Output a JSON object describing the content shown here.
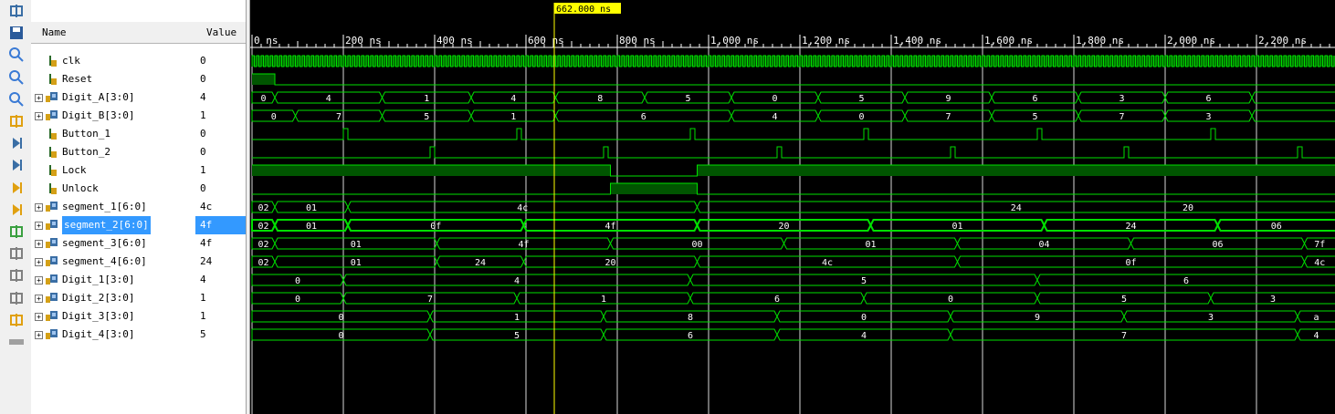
{
  "headers": {
    "name": "Name",
    "value": "Value"
  },
  "cursor": {
    "label": "662.000 ns",
    "time_ns": 662
  },
  "axis_labels": [
    "0 ns",
    "200 ns",
    "400 ns",
    "600 ns",
    "800 ns",
    "1,000 ns",
    "1,200 ns",
    "1,400 ns",
    "1,600 ns",
    "1,800 ns",
    "2,000 ns",
    "2,200 ns"
  ],
  "toolbar": [
    "expand-icon",
    "save-icon",
    "zoom-in-icon",
    "zoom-out-icon",
    "zoom-fit-icon",
    "cursor-icon",
    "go-to-start-icon",
    "go-to-end-icon",
    "previous-transition-icon",
    "next-transition-icon",
    "add-marker-icon",
    "previous-marker-icon",
    "next-marker-icon",
    "swap-icon",
    "snap-icon",
    "grid-icon"
  ],
  "signals": [
    {
      "name": "clk",
      "value": "0",
      "kind": "clock",
      "bus": false
    },
    {
      "name": "Reset",
      "value": "0",
      "kind": "bit",
      "bus": false,
      "segments": [
        [
          0,
          50,
          1
        ],
        [
          50,
          2400,
          0
        ]
      ]
    },
    {
      "name": "Digit_A[3:0]",
      "value": "4",
      "kind": "bus",
      "bus": true,
      "segments": [
        [
          0,
          50,
          "0"
        ],
        [
          50,
          285,
          "4"
        ],
        [
          285,
          480,
          "1"
        ],
        [
          480,
          665,
          "4"
        ],
        [
          665,
          860,
          "8"
        ],
        [
          860,
          1050,
          "5"
        ],
        [
          1050,
          1240,
          "0"
        ],
        [
          1240,
          1430,
          "5"
        ],
        [
          1430,
          1620,
          "9"
        ],
        [
          1620,
          1810,
          "6"
        ],
        [
          1810,
          2000,
          "3"
        ],
        [
          2000,
          2190,
          "6"
        ],
        [
          2190,
          2400,
          ""
        ]
      ]
    },
    {
      "name": "Digit_B[3:0]",
      "value": "1",
      "kind": "bus",
      "bus": true,
      "segments": [
        [
          0,
          95,
          "0"
        ],
        [
          95,
          285,
          "7"
        ],
        [
          285,
          480,
          "5"
        ],
        [
          480,
          665,
          "1"
        ],
        [
          665,
          1050,
          "6"
        ],
        [
          1050,
          1240,
          "4"
        ],
        [
          1240,
          1430,
          "0"
        ],
        [
          1430,
          1620,
          "7"
        ],
        [
          1620,
          1810,
          "5"
        ],
        [
          1810,
          2000,
          "7"
        ],
        [
          2000,
          2190,
          "3"
        ],
        [
          2190,
          2400,
          ""
        ]
      ]
    },
    {
      "name": "Button_1",
      "value": "0",
      "kind": "pulse",
      "bus": false,
      "pulses": [
        200,
        580,
        960,
        1340,
        1720,
        2100
      ]
    },
    {
      "name": "Button_2",
      "value": "0",
      "kind": "pulse",
      "bus": false,
      "pulses": [
        390,
        770,
        1150,
        1530,
        1910,
        2290
      ]
    },
    {
      "name": "Lock",
      "value": "1",
      "kind": "bit",
      "bus": false,
      "segments": [
        [
          0,
          785,
          1
        ],
        [
          785,
          975,
          0
        ],
        [
          975,
          2400,
          1
        ]
      ]
    },
    {
      "name": "Unlock",
      "value": "0",
      "kind": "bit",
      "bus": false,
      "segments": [
        [
          0,
          785,
          0
        ],
        [
          785,
          975,
          1
        ],
        [
          975,
          2400,
          0
        ]
      ]
    },
    {
      "name": "segment_1[6:0]",
      "value": "4c",
      "kind": "bus",
      "bus": true,
      "segments": [
        [
          0,
          50,
          "02"
        ],
        [
          50,
          210,
          "01"
        ],
        [
          210,
          975,
          "4c"
        ],
        [
          975,
          2400,
          "24"
        ]
      ],
      "extra_labels": [
        {
          "t": 2050,
          "v": "20"
        }
      ]
    },
    {
      "name": "segment_2[6:0]",
      "value": "4f",
      "kind": "bus",
      "bus": true,
      "selected": true,
      "segments": [
        [
          0,
          50,
          "02"
        ],
        [
          50,
          210,
          "01"
        ],
        [
          210,
          595,
          "0f"
        ],
        [
          595,
          975,
          "4f"
        ],
        [
          975,
          1355,
          "20"
        ],
        [
          1355,
          1735,
          "01"
        ],
        [
          1735,
          2115,
          "24"
        ],
        [
          2115,
          2400,
          "06"
        ]
      ]
    },
    {
      "name": "segment_3[6:0]",
      "value": "4f",
      "kind": "bus",
      "bus": true,
      "segments": [
        [
          0,
          50,
          "02"
        ],
        [
          50,
          405,
          "01"
        ],
        [
          405,
          785,
          "4f"
        ],
        [
          785,
          1165,
          "00"
        ],
        [
          1165,
          1545,
          "01"
        ],
        [
          1545,
          1925,
          "04"
        ],
        [
          1925,
          2305,
          "06"
        ],
        [
          2305,
          2400,
          "7f"
        ]
      ]
    },
    {
      "name": "segment_4[6:0]",
      "value": "24",
      "kind": "bus",
      "bus": true,
      "segments": [
        [
          0,
          50,
          "02"
        ],
        [
          50,
          405,
          "01"
        ],
        [
          405,
          595,
          "24"
        ],
        [
          595,
          975,
          "20"
        ],
        [
          975,
          1545,
          "4c"
        ],
        [
          1545,
          2305,
          "0f"
        ],
        [
          2305,
          2400,
          "4c"
        ]
      ]
    },
    {
      "name": "Digit_1[3:0]",
      "value": "4",
      "kind": "bus",
      "bus": true,
      "segments": [
        [
          0,
          200,
          "0"
        ],
        [
          200,
          960,
          "4"
        ],
        [
          960,
          1720,
          "5"
        ],
        [
          1720,
          2400,
          "6"
        ]
      ]
    },
    {
      "name": "Digit_2[3:0]",
      "value": "1",
      "kind": "bus",
      "bus": true,
      "segments": [
        [
          0,
          200,
          "0"
        ],
        [
          200,
          580,
          "7"
        ],
        [
          580,
          960,
          "1"
        ],
        [
          960,
          1340,
          "6"
        ],
        [
          1340,
          1720,
          "0"
        ],
        [
          1720,
          2100,
          "5"
        ],
        [
          2100,
          2400,
          "3"
        ]
      ]
    },
    {
      "name": "Digit_3[3:0]",
      "value": "1",
      "kind": "bus",
      "bus": true,
      "segments": [
        [
          0,
          390,
          "0"
        ],
        [
          390,
          770,
          "1"
        ],
        [
          770,
          1150,
          "8"
        ],
        [
          1150,
          1530,
          "0"
        ],
        [
          1530,
          1910,
          "9"
        ],
        [
          1910,
          2290,
          "3"
        ],
        [
          2290,
          2400,
          "a"
        ]
      ]
    },
    {
      "name": "Digit_4[3:0]",
      "value": "5",
      "kind": "bus",
      "bus": true,
      "segments": [
        [
          0,
          390,
          "0"
        ],
        [
          390,
          770,
          "5"
        ],
        [
          770,
          1150,
          "6"
        ],
        [
          1150,
          1530,
          "4"
        ],
        [
          1530,
          2290,
          "7"
        ],
        [
          2290,
          2400,
          "4"
        ]
      ]
    }
  ],
  "colors": {
    "wave": "#00e000",
    "fill": "#005500",
    "cursor": "#ffff00",
    "grid": "#ffffff",
    "axis": "#ffffff",
    "background": "#000000",
    "selected": "#3399ff"
  }
}
